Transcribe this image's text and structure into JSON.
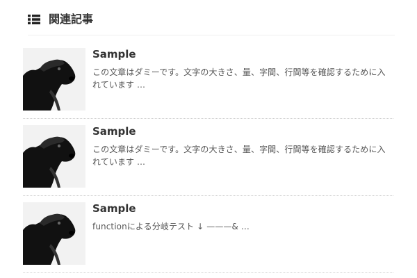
{
  "header": {
    "title": "関連記事",
    "icon": "list-icon"
  },
  "articles": [
    {
      "thumbnail": "dog-photo",
      "title": "Sample",
      "excerpt": "この文章はダミーです。文字の大きさ、量、字間、行間等を確認するために入れています …"
    },
    {
      "thumbnail": "dog-photo",
      "title": "Sample",
      "excerpt": "この文章はダミーです。文字の大きさ、量、字間、行間等を確認するために入れています …"
    },
    {
      "thumbnail": "dog-photo",
      "title": "Sample",
      "excerpt": "functionによる分岐テスト ↓ ———& …"
    }
  ]
}
